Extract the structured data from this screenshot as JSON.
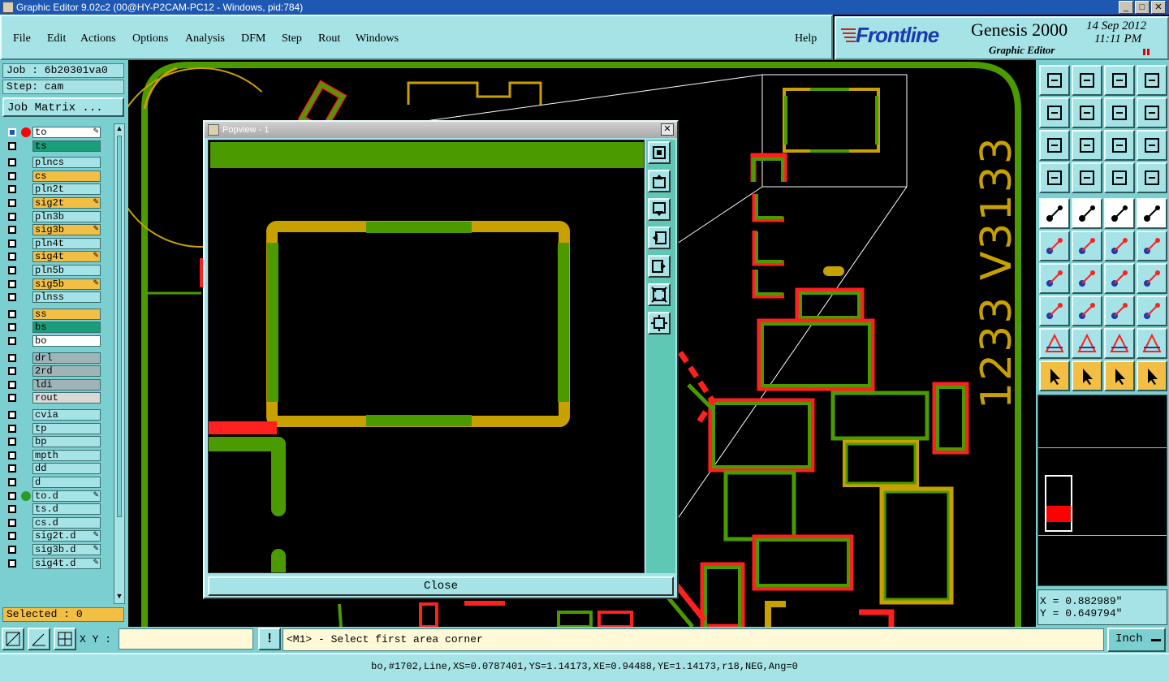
{
  "window": {
    "title": "Graphic Editor 9.02c2 (00@HY-P2CAM-PC12 - Windows, pid:784)"
  },
  "menu": {
    "items": [
      "File",
      "Edit",
      "Actions",
      "Options",
      "Analysis",
      "DFM",
      "Step",
      "Rout",
      "Windows"
    ],
    "help": "Help"
  },
  "brand": {
    "logo": "Frontline",
    "product": "Genesis 2000",
    "subtitle": "Graphic Editor",
    "date": "14 Sep 2012",
    "time": "11:11 PM"
  },
  "job": {
    "job_label": "Job : 6b20301va0",
    "step_label": "Step: cam",
    "matrix_button": "Job Matrix ..."
  },
  "layers": [
    {
      "name": "to",
      "color": "#ffffff",
      "dot": "#ff0000",
      "edit": true,
      "active": true
    },
    {
      "name": "ts",
      "color": "#1a9e7a"
    },
    {
      "name": "plncs",
      "color": "#a5e3e6"
    },
    {
      "name": "cs",
      "color": "#f2be44"
    },
    {
      "name": "pln2t",
      "color": "#a5e3e6"
    },
    {
      "name": "sig2t",
      "color": "#f2be44",
      "edit": true
    },
    {
      "name": "pln3b",
      "color": "#a5e3e6"
    },
    {
      "name": "sig3b",
      "color": "#f2be44",
      "edit": true
    },
    {
      "name": "pln4t",
      "color": "#a5e3e6"
    },
    {
      "name": "sig4t",
      "color": "#f2be44",
      "edit": true
    },
    {
      "name": "pln5b",
      "color": "#a5e3e6"
    },
    {
      "name": "sig5b",
      "color": "#f2be44",
      "edit": true
    },
    {
      "name": "plnss",
      "color": "#a5e3e6"
    },
    {
      "name": "ss",
      "color": "#f2be44"
    },
    {
      "name": "bs",
      "color": "#1a9e7a"
    },
    {
      "name": "bo",
      "color": "#ffffff"
    },
    {
      "name": "drl",
      "color": "#a0b4b8"
    },
    {
      "name": "2rd",
      "color": "#a0b4b8"
    },
    {
      "name": "ldi",
      "color": "#a0b4b8"
    },
    {
      "name": "rout",
      "color": "#d8d8d8"
    },
    {
      "name": "cvia",
      "color": "#a5e3e6"
    },
    {
      "name": "tp",
      "color": "#a5e3e6"
    },
    {
      "name": "bp",
      "color": "#a5e3e6"
    },
    {
      "name": "mpth",
      "color": "#a5e3e6"
    },
    {
      "name": "dd",
      "color": "#a5e3e6"
    },
    {
      "name": "d",
      "color": "#a5e3e6"
    },
    {
      "name": "to.d",
      "color": "#a5e3e6",
      "dot": "#2a9c2a",
      "edit": true
    },
    {
      "name": "ts.d",
      "color": "#a5e3e6"
    },
    {
      "name": "cs.d",
      "color": "#a5e3e6"
    },
    {
      "name": "sig2t.d",
      "color": "#a5e3e6",
      "edit": true
    },
    {
      "name": "sig3b.d",
      "color": "#a5e3e6",
      "edit": true
    },
    {
      "name": "sig4t.d",
      "color": "#a5e3e6",
      "edit": true
    }
  ],
  "selected": "Selected : 0",
  "canvas": {
    "silkscreen_text": "1233 V3133"
  },
  "popview": {
    "title": "Popview - 1",
    "close_label": "Close"
  },
  "coords": {
    "x": "X = 0.882989\"",
    "y": "Y = 0.649794\""
  },
  "prompt": {
    "xy_label": "X Y :",
    "xy_value": "",
    "message": "<M1> - Select first area corner",
    "units": "Inch"
  },
  "status": {
    "text": "bo,#1702,Line,XS=0.0787401,YS=1.14173,XE=0.94488,YE=1.14173,r18,NEG,Ang=0"
  },
  "colors": {
    "panel": "#a5e3e6",
    "panel_dark": "#7ccfd0",
    "green": "#4a9a00",
    "gold": "#c8a000",
    "red": "#ff2020"
  }
}
